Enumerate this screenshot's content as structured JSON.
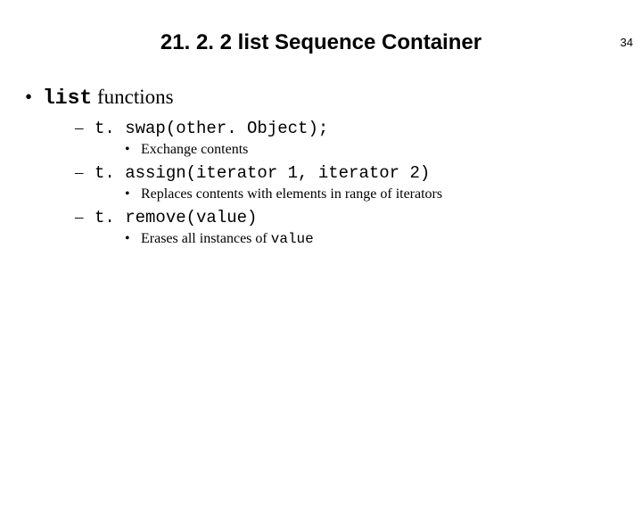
{
  "page_number": "34",
  "title": "21. 2. 2 list Sequence Container",
  "l1": {
    "prefix": "list",
    "suffix": " functions"
  },
  "items": [
    {
      "code": "t. swap(other. Object);",
      "desc": "Exchange contents"
    },
    {
      "code": "t. assign(iterator 1, iterator 2)",
      "desc": "Replaces contents with elements in range of iterators"
    },
    {
      "code": "t. remove(value)",
      "desc_prefix": "Erases all instances of ",
      "desc_mono": "value"
    }
  ]
}
